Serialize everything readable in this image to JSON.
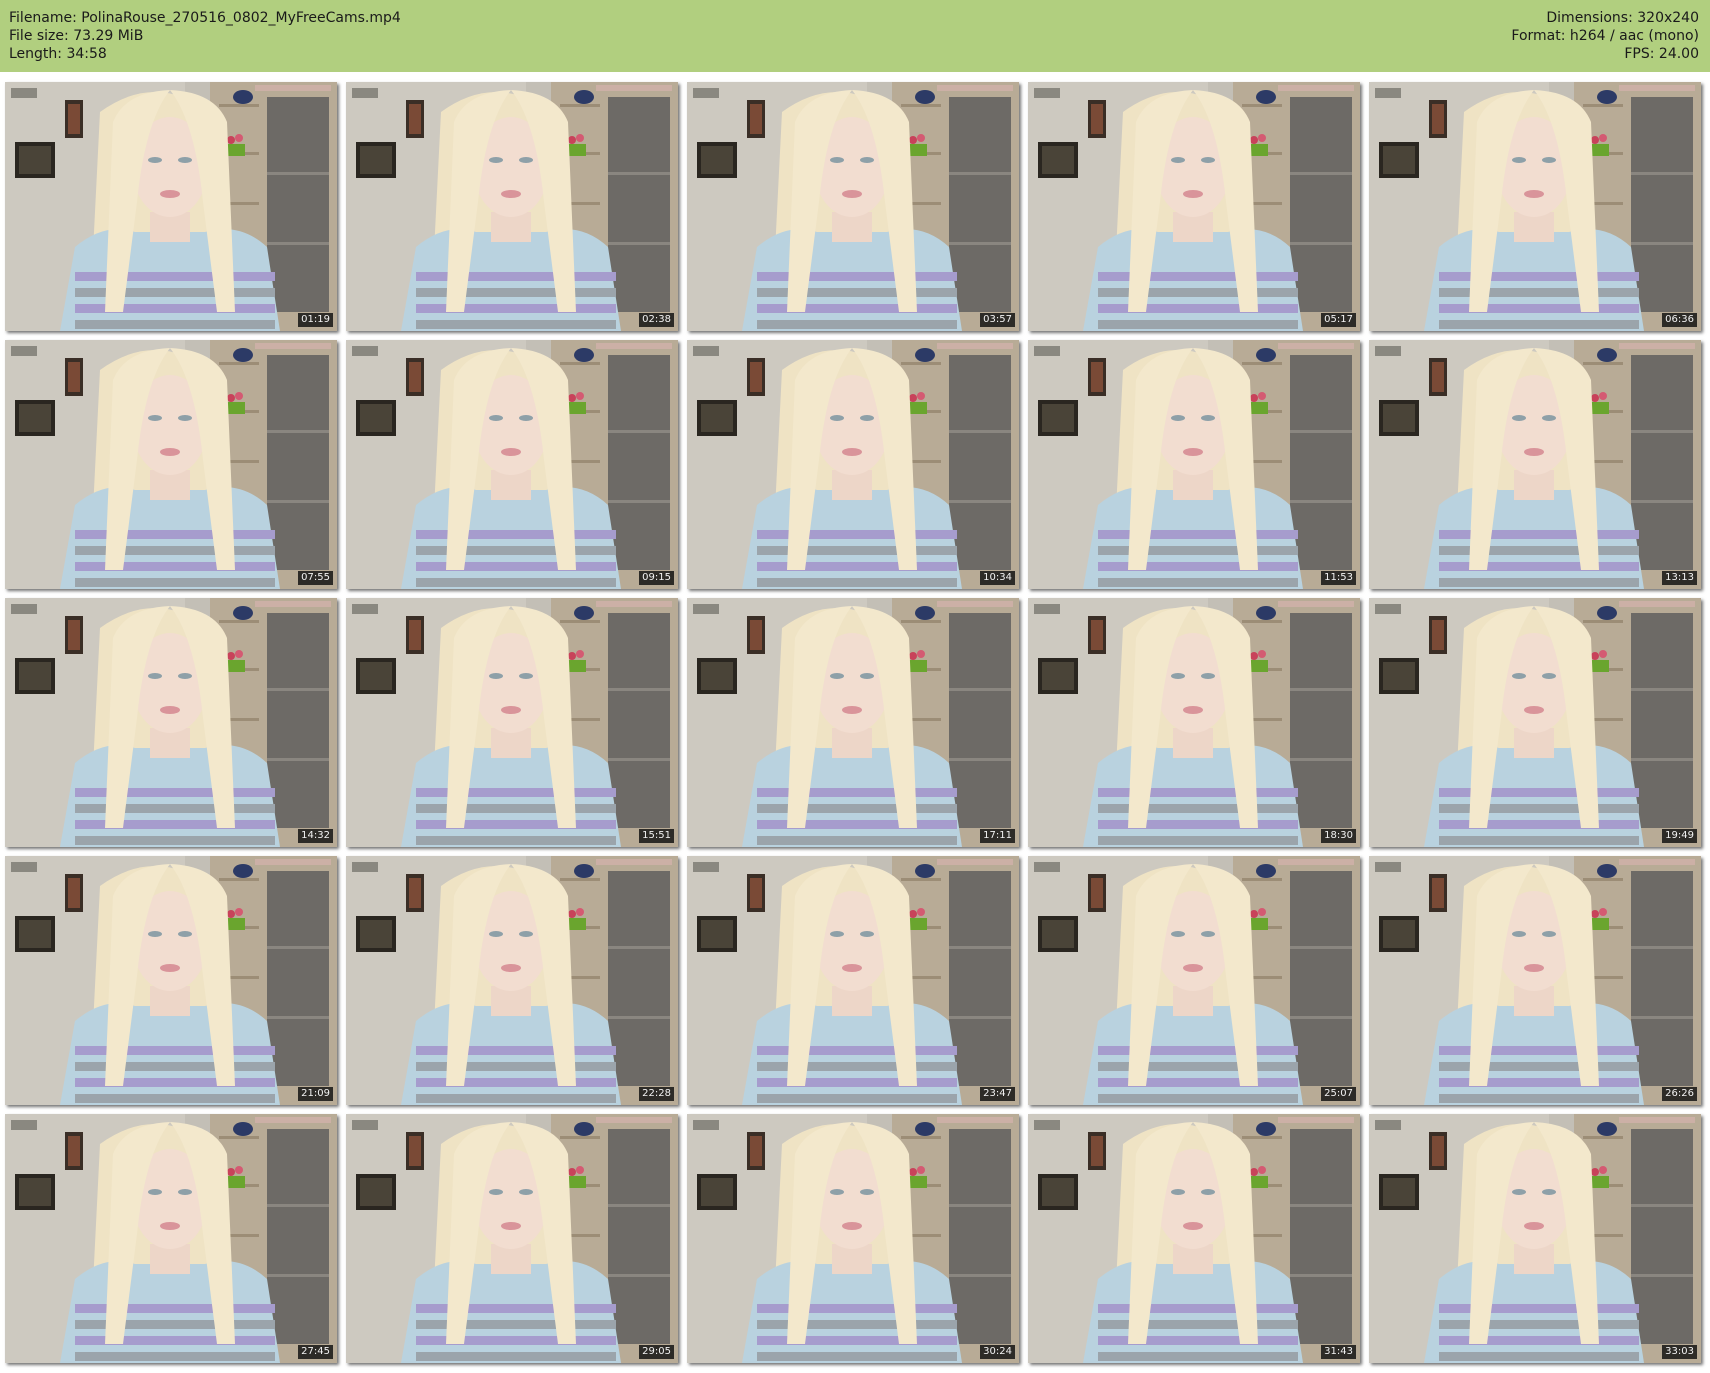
{
  "header": {
    "filename": "Filename: PolinaRouse_270516_0802_MyFreeCams.mp4",
    "file_size": "File size: 73.29 MiB",
    "length": "Length: 34:58",
    "dimensions": "Dimensions: 320x240",
    "format": "Format: h264 / aac (mono)",
    "fps": "FPS: 24.00"
  },
  "colors": {
    "header_bg": "#b1cf7f",
    "background": "#ffffff"
  },
  "thumbnails": [
    {
      "timestamp": "01:19"
    },
    {
      "timestamp": "02:38"
    },
    {
      "timestamp": "03:57"
    },
    {
      "timestamp": "05:17"
    },
    {
      "timestamp": "06:36"
    },
    {
      "timestamp": "07:55"
    },
    {
      "timestamp": "09:15"
    },
    {
      "timestamp": "10:34"
    },
    {
      "timestamp": "11:53"
    },
    {
      "timestamp": "13:13"
    },
    {
      "timestamp": "14:32"
    },
    {
      "timestamp": "15:51"
    },
    {
      "timestamp": "17:11"
    },
    {
      "timestamp": "18:30"
    },
    {
      "timestamp": "19:49"
    },
    {
      "timestamp": "21:09"
    },
    {
      "timestamp": "22:28"
    },
    {
      "timestamp": "23:47"
    },
    {
      "timestamp": "25:07"
    },
    {
      "timestamp": "26:26"
    },
    {
      "timestamp": "27:45"
    },
    {
      "timestamp": "29:05"
    },
    {
      "timestamp": "30:24"
    },
    {
      "timestamp": "31:43"
    },
    {
      "timestamp": "33:03"
    }
  ]
}
